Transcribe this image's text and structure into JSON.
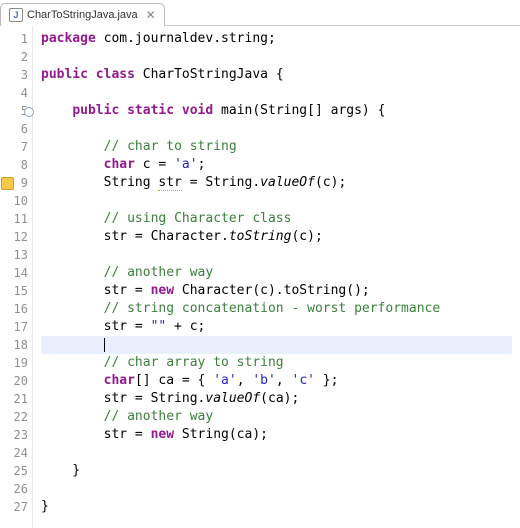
{
  "tab": {
    "filename": "CharToStringJava.java"
  },
  "code": {
    "lines": [
      {
        "num": 1,
        "content": [
          {
            "t": "kw",
            "v": "package"
          },
          {
            "t": "plain",
            "v": " com.journaldev.string;"
          }
        ]
      },
      {
        "num": 2,
        "content": []
      },
      {
        "num": 3,
        "content": [
          {
            "t": "kw",
            "v": "public"
          },
          {
            "t": "plain",
            "v": " "
          },
          {
            "t": "kw",
            "v": "class"
          },
          {
            "t": "plain",
            "v": " CharToStringJava {"
          }
        ]
      },
      {
        "num": 4,
        "content": []
      },
      {
        "num": 5,
        "circ": true,
        "content": [
          {
            "t": "plain",
            "v": "    "
          },
          {
            "t": "kw",
            "v": "public"
          },
          {
            "t": "plain",
            "v": " "
          },
          {
            "t": "kw",
            "v": "static"
          },
          {
            "t": "plain",
            "v": " "
          },
          {
            "t": "kw",
            "v": "void"
          },
          {
            "t": "plain",
            "v": " main(String[] args) {"
          }
        ]
      },
      {
        "num": 6,
        "content": []
      },
      {
        "num": 7,
        "content": [
          {
            "t": "plain",
            "v": "        "
          },
          {
            "t": "comment",
            "v": "// char to string"
          }
        ]
      },
      {
        "num": 8,
        "content": [
          {
            "t": "plain",
            "v": "        "
          },
          {
            "t": "kw",
            "v": "char"
          },
          {
            "t": "plain",
            "v": " c = "
          },
          {
            "t": "string",
            "v": "'a'"
          },
          {
            "t": "plain",
            "v": ";"
          }
        ]
      },
      {
        "num": 9,
        "warn": true,
        "content": [
          {
            "t": "plain",
            "v": "        String "
          },
          {
            "t": "warnvar",
            "v": "str"
          },
          {
            "t": "plain",
            "v": " = String."
          },
          {
            "t": "static",
            "v": "valueOf"
          },
          {
            "t": "plain",
            "v": "(c);"
          }
        ]
      },
      {
        "num": 10,
        "content": []
      },
      {
        "num": 11,
        "content": [
          {
            "t": "plain",
            "v": "        "
          },
          {
            "t": "comment",
            "v": "// using Character class"
          }
        ]
      },
      {
        "num": 12,
        "content": [
          {
            "t": "plain",
            "v": "        str = Character."
          },
          {
            "t": "static",
            "v": "toString"
          },
          {
            "t": "plain",
            "v": "(c);"
          }
        ]
      },
      {
        "num": 13,
        "content": []
      },
      {
        "num": 14,
        "content": [
          {
            "t": "plain",
            "v": "        "
          },
          {
            "t": "comment",
            "v": "// another way"
          }
        ]
      },
      {
        "num": 15,
        "content": [
          {
            "t": "plain",
            "v": "        str = "
          },
          {
            "t": "kw",
            "v": "new"
          },
          {
            "t": "plain",
            "v": " Character(c).toString();"
          }
        ]
      },
      {
        "num": 16,
        "content": [
          {
            "t": "plain",
            "v": "        "
          },
          {
            "t": "comment",
            "v": "// string concatenation - worst performance"
          }
        ]
      },
      {
        "num": 17,
        "content": [
          {
            "t": "plain",
            "v": "        str = "
          },
          {
            "t": "string",
            "v": "\"\""
          },
          {
            "t": "plain",
            "v": " + c;"
          }
        ]
      },
      {
        "num": 18,
        "hl": true,
        "content": [
          {
            "t": "plain",
            "v": "        "
          },
          {
            "t": "caret",
            "v": ""
          }
        ]
      },
      {
        "num": 19,
        "content": [
          {
            "t": "plain",
            "v": "        "
          },
          {
            "t": "comment",
            "v": "// char array to string"
          }
        ]
      },
      {
        "num": 20,
        "content": [
          {
            "t": "plain",
            "v": "        "
          },
          {
            "t": "kw",
            "v": "char"
          },
          {
            "t": "plain",
            "v": "[] ca = { "
          },
          {
            "t": "string",
            "v": "'a'"
          },
          {
            "t": "plain",
            "v": ", "
          },
          {
            "t": "string",
            "v": "'b'"
          },
          {
            "t": "plain",
            "v": ", "
          },
          {
            "t": "string",
            "v": "'c'"
          },
          {
            "t": "plain",
            "v": " };"
          }
        ]
      },
      {
        "num": 21,
        "content": [
          {
            "t": "plain",
            "v": "        str = String."
          },
          {
            "t": "static",
            "v": "valueOf"
          },
          {
            "t": "plain",
            "v": "(ca);"
          }
        ]
      },
      {
        "num": 22,
        "content": [
          {
            "t": "plain",
            "v": "        "
          },
          {
            "t": "comment",
            "v": "// another way"
          }
        ]
      },
      {
        "num": 23,
        "content": [
          {
            "t": "plain",
            "v": "        str = "
          },
          {
            "t": "kw",
            "v": "new"
          },
          {
            "t": "plain",
            "v": " String(ca);"
          }
        ]
      },
      {
        "num": 24,
        "content": []
      },
      {
        "num": 25,
        "content": [
          {
            "t": "plain",
            "v": "    }"
          }
        ]
      },
      {
        "num": 26,
        "content": []
      },
      {
        "num": 27,
        "content": [
          {
            "t": "plain",
            "v": "}"
          }
        ]
      }
    ]
  }
}
